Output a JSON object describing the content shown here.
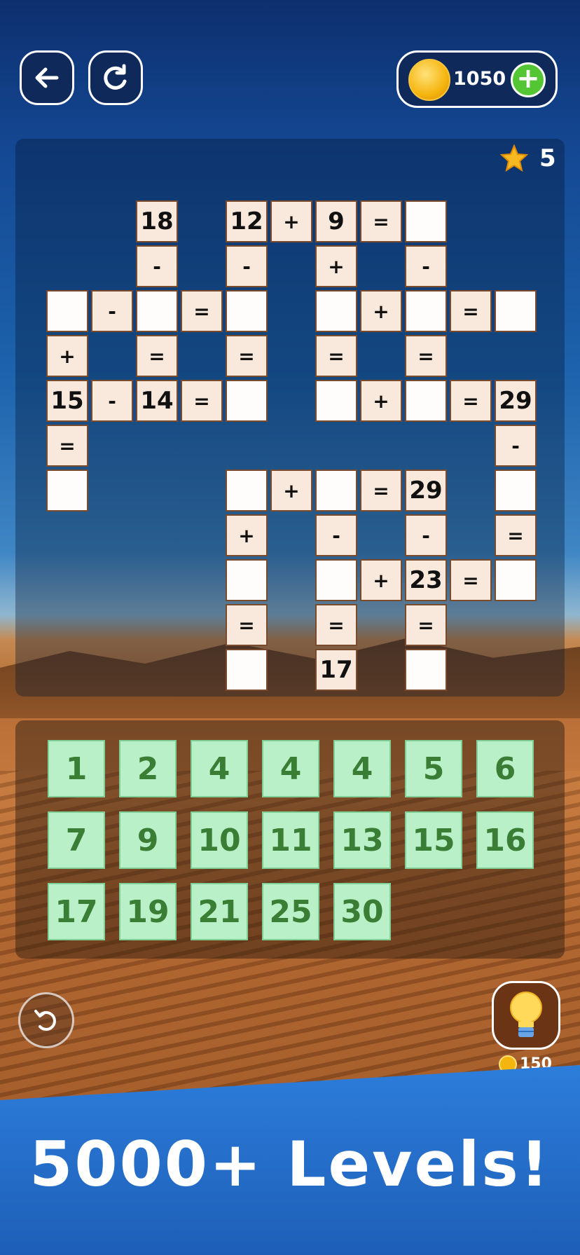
{
  "header": {
    "back_icon": "arrow-left-icon",
    "restart_icon": "restart-icon",
    "coins": "1050",
    "coin_plus": "+"
  },
  "stars": {
    "count": "5",
    "icon": "star-icon"
  },
  "grid": {
    "cells": [
      {
        "r": 0,
        "c": 2,
        "t": "18",
        "k": "num"
      },
      {
        "r": 0,
        "c": 4,
        "t": "12",
        "k": "num"
      },
      {
        "r": 0,
        "c": 5,
        "t": "+",
        "k": "op"
      },
      {
        "r": 0,
        "c": 6,
        "t": "9",
        "k": "num"
      },
      {
        "r": 0,
        "c": 7,
        "t": "=",
        "k": "op"
      },
      {
        "r": 0,
        "c": 8,
        "t": "",
        "k": "blank"
      },
      {
        "r": 1,
        "c": 2,
        "t": "-",
        "k": "op"
      },
      {
        "r": 1,
        "c": 4,
        "t": "-",
        "k": "op"
      },
      {
        "r": 1,
        "c": 6,
        "t": "+",
        "k": "op"
      },
      {
        "r": 1,
        "c": 8,
        "t": "-",
        "k": "op"
      },
      {
        "r": 2,
        "c": 0,
        "t": "",
        "k": "blank"
      },
      {
        "r": 2,
        "c": 1,
        "t": "-",
        "k": "op"
      },
      {
        "r": 2,
        "c": 2,
        "t": "",
        "k": "blank"
      },
      {
        "r": 2,
        "c": 3,
        "t": "=",
        "k": "op"
      },
      {
        "r": 2,
        "c": 4,
        "t": "",
        "k": "blank"
      },
      {
        "r": 2,
        "c": 6,
        "t": "",
        "k": "blank"
      },
      {
        "r": 2,
        "c": 7,
        "t": "+",
        "k": "op"
      },
      {
        "r": 2,
        "c": 8,
        "t": "",
        "k": "blank"
      },
      {
        "r": 2,
        "c": 9,
        "t": "=",
        "k": "op"
      },
      {
        "r": 2,
        "c": 10,
        "t": "",
        "k": "blank"
      },
      {
        "r": 3,
        "c": 0,
        "t": "+",
        "k": "op"
      },
      {
        "r": 3,
        "c": 2,
        "t": "=",
        "k": "op"
      },
      {
        "r": 3,
        "c": 4,
        "t": "=",
        "k": "op"
      },
      {
        "r": 3,
        "c": 6,
        "t": "=",
        "k": "op"
      },
      {
        "r": 3,
        "c": 8,
        "t": "=",
        "k": "op"
      },
      {
        "r": 4,
        "c": 0,
        "t": "15",
        "k": "num"
      },
      {
        "r": 4,
        "c": 1,
        "t": "-",
        "k": "op"
      },
      {
        "r": 4,
        "c": 2,
        "t": "14",
        "k": "num"
      },
      {
        "r": 4,
        "c": 3,
        "t": "=",
        "k": "op"
      },
      {
        "r": 4,
        "c": 4,
        "t": "",
        "k": "blank"
      },
      {
        "r": 4,
        "c": 6,
        "t": "",
        "k": "blank"
      },
      {
        "r": 4,
        "c": 7,
        "t": "+",
        "k": "op"
      },
      {
        "r": 4,
        "c": 8,
        "t": "",
        "k": "blank"
      },
      {
        "r": 4,
        "c": 9,
        "t": "=",
        "k": "op"
      },
      {
        "r": 4,
        "c": 10,
        "t": "29",
        "k": "num"
      },
      {
        "r": 5,
        "c": 0,
        "t": "=",
        "k": "op"
      },
      {
        "r": 5,
        "c": 10,
        "t": "-",
        "k": "op"
      },
      {
        "r": 6,
        "c": 0,
        "t": "",
        "k": "blank"
      },
      {
        "r": 6,
        "c": 4,
        "t": "",
        "k": "blank"
      },
      {
        "r": 6,
        "c": 5,
        "t": "+",
        "k": "op"
      },
      {
        "r": 6,
        "c": 6,
        "t": "",
        "k": "blank"
      },
      {
        "r": 6,
        "c": 7,
        "t": "=",
        "k": "op"
      },
      {
        "r": 6,
        "c": 8,
        "t": "29",
        "k": "num"
      },
      {
        "r": 6,
        "c": 10,
        "t": "",
        "k": "blank"
      },
      {
        "r": 7,
        "c": 4,
        "t": "+",
        "k": "op"
      },
      {
        "r": 7,
        "c": 6,
        "t": "-",
        "k": "op"
      },
      {
        "r": 7,
        "c": 8,
        "t": "-",
        "k": "op"
      },
      {
        "r": 7,
        "c": 10,
        "t": "=",
        "k": "op"
      },
      {
        "r": 8,
        "c": 4,
        "t": "",
        "k": "blank"
      },
      {
        "r": 8,
        "c": 6,
        "t": "",
        "k": "blank"
      },
      {
        "r": 8,
        "c": 7,
        "t": "+",
        "k": "op"
      },
      {
        "r": 8,
        "c": 8,
        "t": "23",
        "k": "num"
      },
      {
        "r": 8,
        "c": 9,
        "t": "=",
        "k": "op"
      },
      {
        "r": 8,
        "c": 10,
        "t": "",
        "k": "blank"
      },
      {
        "r": 9,
        "c": 4,
        "t": "=",
        "k": "op"
      },
      {
        "r": 9,
        "c": 6,
        "t": "=",
        "k": "op"
      },
      {
        "r": 9,
        "c": 8,
        "t": "=",
        "k": "op"
      },
      {
        "r": 10,
        "c": 4,
        "t": "",
        "k": "blank"
      },
      {
        "r": 10,
        "c": 6,
        "t": "17",
        "k": "num"
      },
      {
        "r": 10,
        "c": 8,
        "t": "",
        "k": "blank"
      }
    ]
  },
  "tray": {
    "tiles": [
      "1",
      "2",
      "4",
      "4",
      "4",
      "5",
      "6",
      "7",
      "9",
      "10",
      "11",
      "13",
      "15",
      "16",
      "17",
      "19",
      "21",
      "25",
      "30"
    ]
  },
  "undo_icon": "undo-icon",
  "hint": {
    "icon": "lightbulb-icon",
    "cost": "150"
  },
  "banner": {
    "text": "5000+ Levels!"
  }
}
